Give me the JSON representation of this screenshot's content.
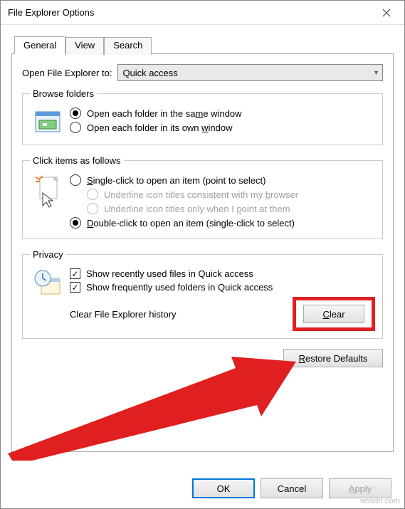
{
  "window": {
    "title": "File Explorer Options"
  },
  "tabs": {
    "general": "General",
    "view": "View",
    "search": "Search"
  },
  "openTo": {
    "label": "Open File Explorer to:",
    "value": "Quick access"
  },
  "browse": {
    "legend": "Browse folders",
    "same": "Open each folder in the same window",
    "own": "Open each folder in its own window"
  },
  "click": {
    "legend": "Click items as follows",
    "single": "Single-click to open an item (point to select)",
    "uBrowser": "Underline icon titles consistent with my browser",
    "uPoint": "Underline icon titles only when I point at them",
    "double": "Double-click to open an item (single-click to select)"
  },
  "privacy": {
    "legend": "Privacy",
    "recent": "Show recently used files in Quick access",
    "frequent": "Show frequently used folders in Quick access",
    "clearLabel": "Clear File Explorer history",
    "clearBtn": "Clear"
  },
  "restore": "Restore Defaults",
  "footer": {
    "ok": "OK",
    "cancel": "Cancel",
    "apply": "Apply"
  },
  "watermark": "wsxdn.com"
}
